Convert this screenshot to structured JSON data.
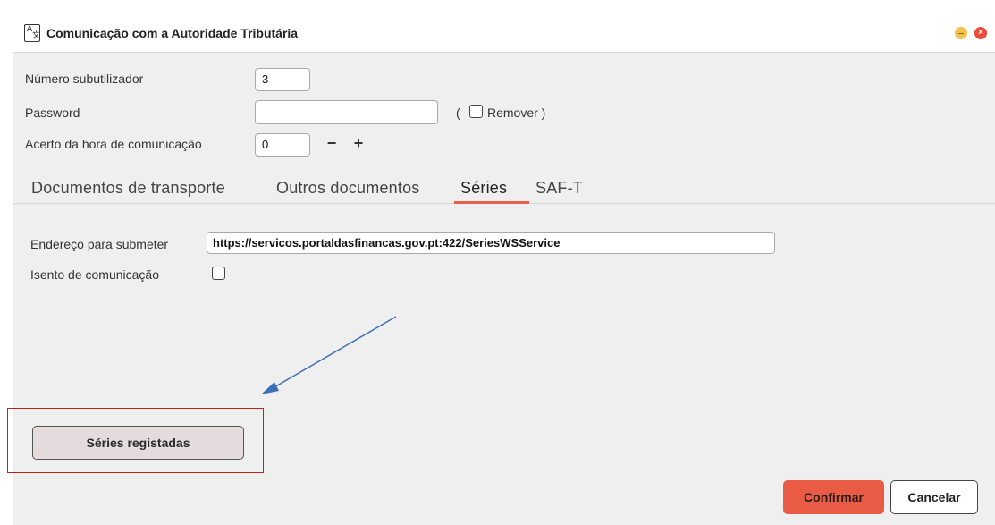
{
  "window": {
    "title": "Comunicação com a Autoridade Tributária",
    "minimize_icon": "minimize-icon",
    "close_icon": "close-icon"
  },
  "form": {
    "subuser_label": "Número subutilizador",
    "subuser_value": "3",
    "password_label": "Password",
    "password_value": "",
    "remove_open": "(",
    "remove_label": "Remover )",
    "time_adjust_label": "Acerto da hora de comunicação",
    "time_adjust_value": "0",
    "minus_label": "−",
    "plus_label": "+"
  },
  "tabs": [
    {
      "label": "Documentos de transporte",
      "active": false
    },
    {
      "label": "Outros documentos",
      "active": false
    },
    {
      "label": "Séries",
      "active": true
    },
    {
      "label": "SAF-T",
      "active": false
    }
  ],
  "series_tab": {
    "endpoint_label": "Endereço para submeter",
    "endpoint_value": "https://servicos.portaldasfinancas.gov.pt:422/SeriesWSService",
    "exempt_label": "Isento de comunicação",
    "exempt_checked": false
  },
  "buttons": {
    "registered_series": "Séries registadas",
    "confirm": "Confirmar",
    "cancel": "Cancelar"
  },
  "colors": {
    "accent": "#ea5b46",
    "annotation_arrow": "#3b6fb6",
    "annotation_box": "#c0201a"
  }
}
